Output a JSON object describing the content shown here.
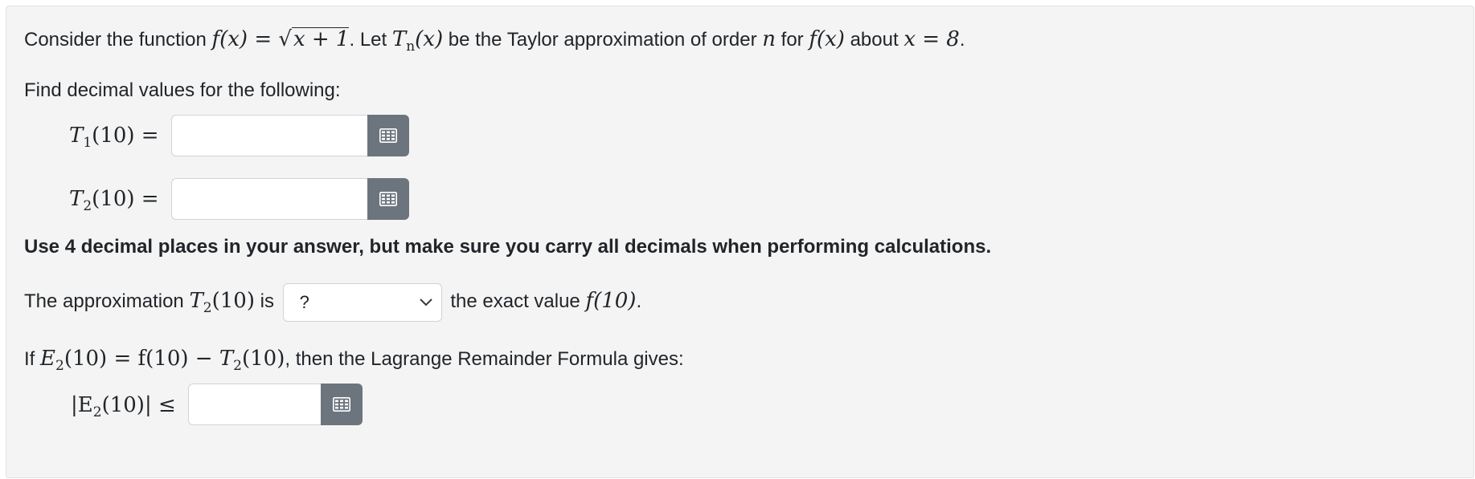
{
  "intro": {
    "t1": "Consider the function ",
    "fx": "f(x) = ",
    "sqrt": "x + 1",
    "t2": ". Let ",
    "Tn": "T",
    "n": "n",
    "x_arg": "(x)",
    "t3": " be the Taylor approximation of order ",
    "order": "n",
    "t4": " for ",
    "fx2": "f(x)",
    "t5": " about ",
    "x_eq": "x = 8",
    "t6": "."
  },
  "find_text": "Find decimal values for the following:",
  "q1": {
    "T": "T",
    "sub": "1",
    "rest": "(10) =",
    "value": ""
  },
  "q2": {
    "T": "T",
    "sub": "2",
    "rest": "(10) =",
    "value": ""
  },
  "note": "Use 4 decimal places in your answer, but make sure you carry all decimals when performing calculations.",
  "comparison": {
    "t1": "The approximation ",
    "T": "T",
    "sub": "2",
    "arg": "(10)",
    "t2": " is ",
    "select_value": "?",
    "t3": " the exact value ",
    "f": "f(10)",
    "t4": "."
  },
  "remainder": {
    "t1": "If ",
    "E": "E",
    "sub": "2",
    "eq": "(10) = f(10) − ",
    "T": "T",
    "sub2": "2",
    "arg": "(10)",
    "t2": ", then the Lagrange Remainder Formula gives:"
  },
  "q3": {
    "label_pre": "|E",
    "sub": "2",
    "label_post": "(10)| ≤",
    "value": ""
  },
  "icons": {
    "calculator": "calculator-grid-icon",
    "dropdown": "chevron-down-icon"
  }
}
